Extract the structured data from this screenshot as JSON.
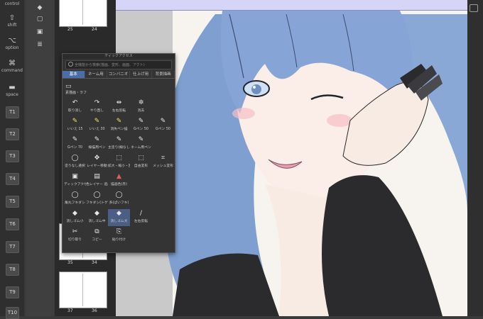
{
  "keybar": {
    "keys": [
      {
        "label": "control",
        "icon": ""
      },
      {
        "label": "shift",
        "icon": "⇧"
      },
      {
        "label": "option",
        "icon": "⌥"
      },
      {
        "label": "command",
        "icon": "⌘"
      },
      {
        "label": "space",
        "icon": "▬"
      }
    ],
    "tkeys": [
      "T1",
      "T2",
      "T3",
      "T4",
      "T5",
      "T6",
      "T7",
      "T8",
      "T9",
      "T10"
    ]
  },
  "pages": {
    "labels": [
      {
        "left": "25",
        "right": "24"
      },
      {
        "left": "35",
        "right": "34"
      },
      {
        "left": "37",
        "right": "36"
      }
    ]
  },
  "palette": {
    "title": "ティックアクセス",
    "search_placeholder": "全機能から検索(描画、変形、画面、アクト)",
    "tabs": [
      "基本",
      "ネーム用",
      "コンバニオ",
      "仕上げ用",
      "背景描画"
    ],
    "active_tab": 0,
    "row0": {
      "label": "素描画・ラフ"
    },
    "rows": [
      [
        {
          "g": "↶",
          "l": "取り消し"
        },
        {
          "g": "↷",
          "l": "やり直し"
        },
        {
          "g": "⇹",
          "l": "左右反転"
        },
        {
          "g": "✲",
          "l": "消去"
        }
      ],
      [
        {
          "g": "✎",
          "l": "いいえ 15"
        },
        {
          "g": "✎",
          "l": "いいえ 30"
        },
        {
          "g": "✎",
          "l": "消失ペン描"
        },
        {
          "g": "✎",
          "l": "Gペン 50"
        },
        {
          "g": "✎",
          "l": "Gペン 50"
        }
      ],
      [
        {
          "g": "✎",
          "l": "Gペン 70"
        },
        {
          "g": "✎",
          "l": "線描用ペン"
        },
        {
          "g": "✎",
          "l": "主塗り(線なし)"
        },
        {
          "g": "✎",
          "l": "ネーム用ペン"
        }
      ],
      [
        {
          "g": "◯",
          "l": "塗りなし選択"
        },
        {
          "g": "✥",
          "l": "レイヤー移動"
        },
        {
          "g": "⬚",
          "l": "拡大・縮小・回転"
        },
        {
          "g": "⬚",
          "l": "自由変形"
        },
        {
          "g": "⌗",
          "l": "メッシュ変形"
        }
      ],
      [
        {
          "g": "▣",
          "l": "ディックアクセス"
        },
        {
          "g": "▤",
          "l": "色レイヤー 追加"
        },
        {
          "g": "▲",
          "l": "描画色(赤)"
        }
      ],
      [
        {
          "g": "◯",
          "l": "角丸フキダシ"
        },
        {
          "g": "◯",
          "l": "フキダシ(トゲ)"
        },
        {
          "g": "◯",
          "l": "多(ぱいフキ)"
        }
      ],
      [
        {
          "g": "◆",
          "l": "消しゴム小"
        },
        {
          "g": "◆",
          "l": "消しゴム中"
        },
        {
          "g": "◆",
          "l": "消しゴム大"
        },
        {
          "g": "∕",
          "l": "左右反転"
        }
      ],
      [
        {
          "g": "✂",
          "l": "切り取り"
        },
        {
          "g": "⧉",
          "l": "コピー"
        },
        {
          "g": "⎘",
          "l": "貼り付け"
        }
      ]
    ]
  },
  "colors": {
    "accent": "#4a6fa8",
    "bluebar": "#d6d4f7",
    "hair": "#7f9fd0",
    "sleeve": "#2b2b2e"
  }
}
